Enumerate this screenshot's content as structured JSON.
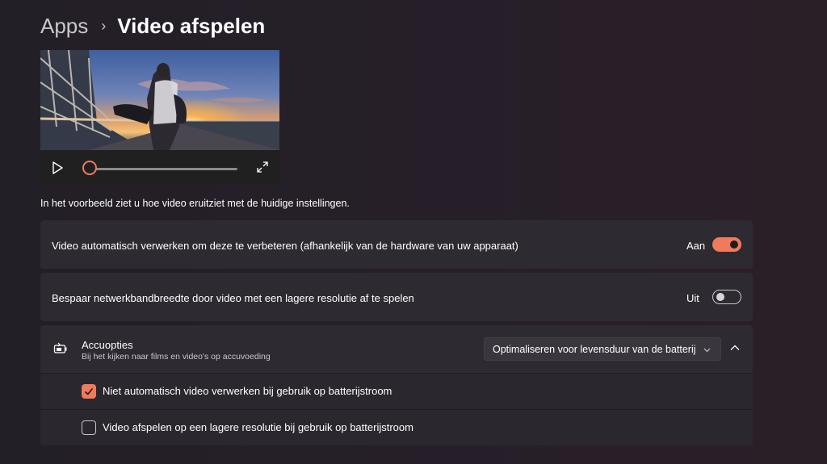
{
  "breadcrumb": {
    "parent": "Apps",
    "separator": "›",
    "current": "Video afspelen"
  },
  "preview": {
    "description": "In het voorbeeld ziet u hoe video eruitziet met de huidige instellingen.",
    "progress": 0
  },
  "settings": [
    {
      "label": "Video automatisch verwerken om deze te verbeteren (afhankelijk van de hardware van uw apparaat)",
      "state": "Aan",
      "on": true
    },
    {
      "label": "Bespaar netwerkbandbreedte door video met een lagere resolutie af te spelen",
      "state": "Uit",
      "on": false
    }
  ],
  "battery": {
    "title": "Accuopties",
    "subtitle": "Bij het kijken naar films en video's op accuvoeding",
    "dropdown_value": "Optimaliseren voor levensduur van de batterij",
    "options": [
      {
        "label": "Niet automatisch video verwerken bij gebruik op batterijstroom",
        "checked": true
      },
      {
        "label": "Video afspelen op een lagere resolutie bij gebruik op batterijstroom",
        "checked": false
      }
    ]
  },
  "colors": {
    "accent": "#f07a5c",
    "card": "#2e2a31",
    "background": "#231f26"
  }
}
